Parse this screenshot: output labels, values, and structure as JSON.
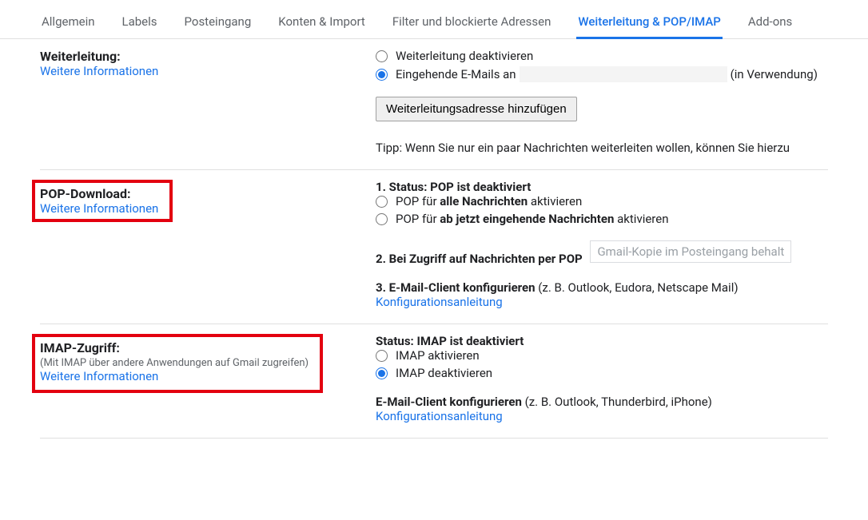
{
  "tabs": {
    "t0": "Allgemein",
    "t1": "Labels",
    "t2": "Posteingang",
    "t3": "Konten & Import",
    "t4": "Filter und blockierte Adressen",
    "t5": "Weiterleitung & POP/IMAP",
    "t6": "Add-ons"
  },
  "forwarding": {
    "title": "Weiterleitung:",
    "more_info": "Weitere Informationen",
    "opt_disable": "Weiterleitung deaktivieren",
    "opt_enable_prefix": "Eingehende E-Mails an",
    "opt_enable_suffix": "(in Verwendung)",
    "add_address_btn": "Weiterleitungsadresse hinzufügen",
    "tip": "Tipp: Wenn Sie nur ein paar Nachrichten weiterleiten wollen, können Sie hierzu"
  },
  "pop": {
    "title": "POP-Download:",
    "more_info": "Weitere Informationen",
    "status_label": "1. Status: ",
    "status_value": "POP ist deaktiviert",
    "opt_all_pre": "POP für ",
    "opt_all_bold": "alle Nachrichten",
    "opt_all_post": " aktivieren",
    "opt_now_pre": "POP für ",
    "opt_now_bold": "ab jetzt eingehende Nachrichten",
    "opt_now_post": " aktivieren",
    "access_label": "2. Bei Zugriff auf Nachrichten per POP",
    "access_placeholder": "Gmail-Kopie im Posteingang behalt",
    "client_label": "3. E-Mail-Client konfigurieren",
    "client_hint": " (z. B. Outlook, Eudora, Netscape Mail)",
    "config_link": "Konfigurationsanleitung"
  },
  "imap": {
    "title": "IMAP-Zugriff:",
    "subtitle": "(Mit IMAP über andere Anwendungen auf Gmail zugreifen)",
    "more_info": "Weitere Informationen",
    "status_label": "Status: ",
    "status_value": "IMAP ist deaktiviert",
    "opt_enable": "IMAP aktivieren",
    "opt_disable": "IMAP deaktivieren",
    "client_label": "E-Mail-Client konfigurieren",
    "client_hint": " (z. B. Outlook, Thunderbird, iPhone)",
    "config_link": "Konfigurationsanleitung"
  }
}
